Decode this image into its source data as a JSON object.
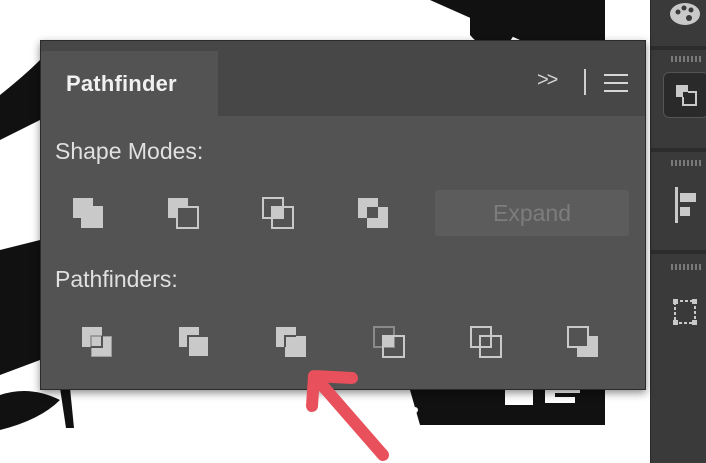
{
  "panel": {
    "title": "Pathfinder",
    "collapse_glyph": ">>",
    "menu_icon": "hamburger-menu-icon"
  },
  "shape_modes": {
    "label": "Shape Modes:",
    "buttons": [
      "unite-icon",
      "minus-front-icon",
      "intersect-icon",
      "exclude-icon"
    ],
    "expand_label": "Expand",
    "expand_enabled": false
  },
  "pathfinders": {
    "label": "Pathfinders:",
    "buttons": [
      "divide-icon",
      "trim-icon",
      "merge-icon",
      "crop-icon",
      "outline-icon",
      "minus-back-icon"
    ]
  },
  "dock": {
    "items": [
      "palette-icon",
      "pathfinder-dock-icon",
      "align-dock-icon",
      "transform-dock-icon"
    ],
    "active": "pathfinder-dock-icon"
  },
  "colors": {
    "panel_bg": "#535353",
    "header_bg": "#474747",
    "icon_fill": "#c9c9c9",
    "annotation_arrow": "#e8505b"
  }
}
